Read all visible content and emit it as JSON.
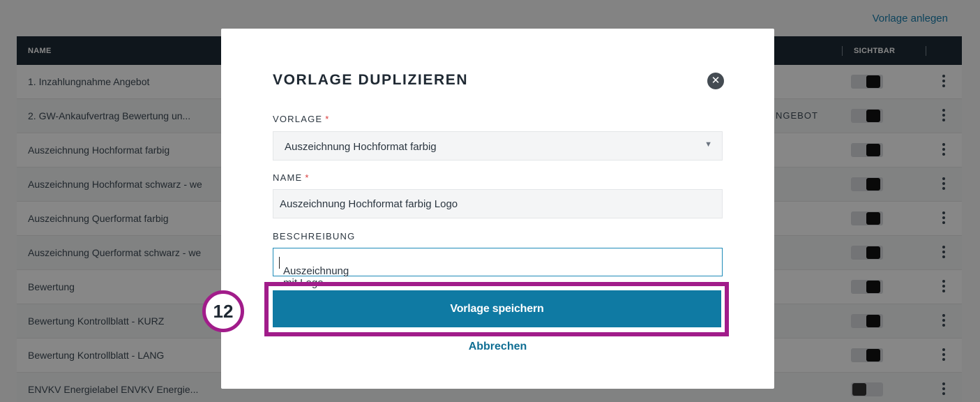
{
  "page": {
    "top_link": "Vorlage anlegen"
  },
  "table": {
    "headers": {
      "name": "NAME",
      "visible": "SICHTBAR"
    },
    "rows": [
      {
        "name": "1. Inzahlungnahme Angebot",
        "tag": "",
        "visible": true
      },
      {
        "name": "2. GW-Ankaufvertrag  Bewertung un...",
        "tag": "NGEBOT",
        "visible": true
      },
      {
        "name": "Auszeichnung Hochformat farbig",
        "tag": "",
        "visible": true
      },
      {
        "name": "Auszeichnung Hochformat schwarz - we",
        "tag": "",
        "visible": true
      },
      {
        "name": "Auszeichnung Querformat farbig",
        "tag": "",
        "visible": true
      },
      {
        "name": "Auszeichnung Querformat schwarz - we",
        "tag": "",
        "visible": true
      },
      {
        "name": "Bewertung",
        "tag": "",
        "visible": true
      },
      {
        "name": "Bewertung Kontrollblatt - KURZ",
        "tag": "",
        "visible": true
      },
      {
        "name": "Bewertung Kontrollblatt - LANG",
        "tag": "",
        "visible": true
      },
      {
        "name": "ENVKV Energielabel  ENVKV Energie...",
        "tag": "",
        "visible": false
      }
    ]
  },
  "modal": {
    "title": "VORLAGE DUPLIZIEREN",
    "close_icon": "close-icon",
    "template_label": "VORLAGE",
    "template_value": "Auszeichnung Hochformat farbig",
    "name_label": "NAME",
    "name_value": "Auszeichnung Hochformat farbig Logo",
    "description_label": "BESCHREIBUNG",
    "description_value": "Auszeichnung mit Logo",
    "required_mark": "*",
    "save_label": "Vorlage speichern",
    "cancel_label": "Abbrechen"
  },
  "annotation": {
    "step_number": "12",
    "highlight_color": "#a11c8a"
  },
  "colors": {
    "accent": "#0f7aa3",
    "header_bg": "#1d2a35",
    "required": "#d93a3a"
  }
}
